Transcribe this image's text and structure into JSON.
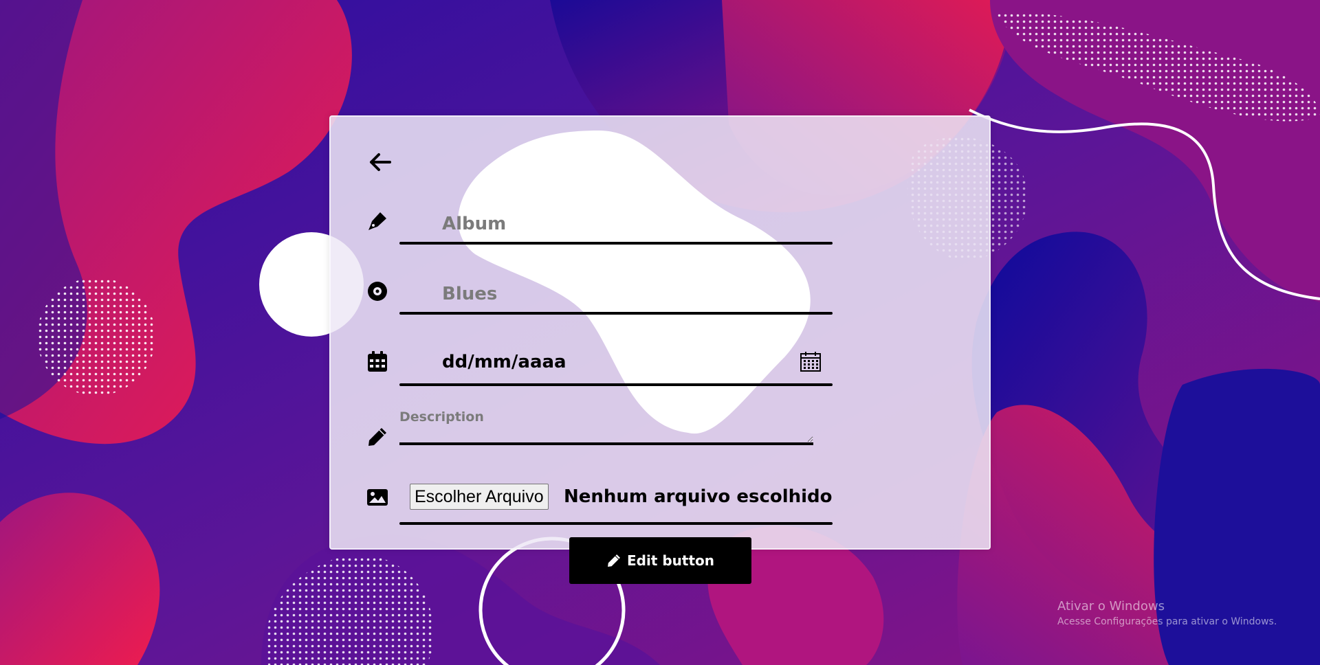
{
  "form": {
    "back_icon": "arrow-left-icon",
    "album": {
      "icon": "pen-fancy-icon",
      "placeholder": "Album"
    },
    "genre": {
      "icon": "compact-disc-icon",
      "placeholder": "Blues"
    },
    "date": {
      "icon": "calendar-icon",
      "value": "dd/mm/aaaa",
      "picker_icon": "calendar-picker-icon"
    },
    "description": {
      "icon": "pencil-icon",
      "placeholder": "Description"
    },
    "image": {
      "icon": "image-icon",
      "button_label": "Escolher Arquivo",
      "status": "Nenhum arquivo escolhido"
    }
  },
  "edit_button": {
    "icon": "pencil-icon",
    "label": "Edit button"
  },
  "watermark": {
    "title": "Ativar o Windows",
    "subtitle": "Acesse Configurações para ativar o Windows."
  },
  "colors": {
    "deep_blue": "#1a0a9e",
    "purple": "#6a169a",
    "magenta": "#b8177c",
    "pink_red": "#e81a55",
    "panel": "#eee8f6",
    "button": "#000000"
  }
}
